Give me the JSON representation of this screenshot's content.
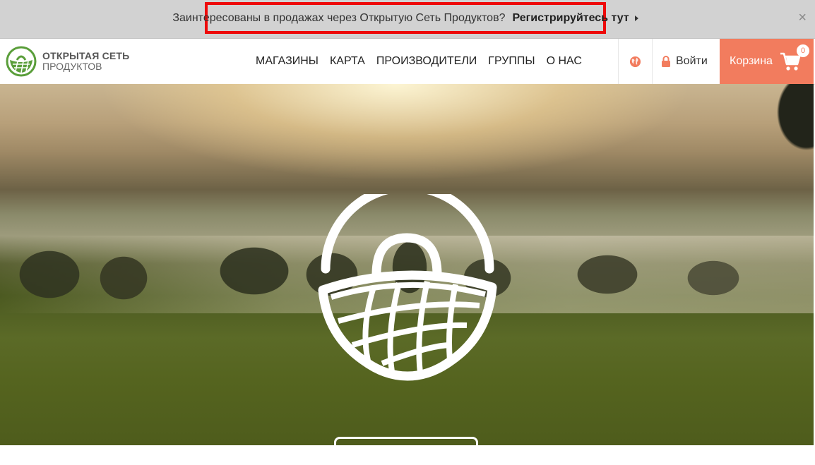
{
  "announcement": {
    "question": "Заинтересованы в продажах через Открытую Сеть Продуктов?",
    "cta": "Регистрируйтесь тут",
    "close": "×"
  },
  "header": {
    "logo_line1": "ОТКРЫТАЯ СЕТЬ",
    "logo_line2": "ПРОДУКТОВ",
    "menu": [
      {
        "label": "МАГАЗИНЫ"
      },
      {
        "label": "КАРТА"
      },
      {
        "label": "ПРОИЗВОДИТЕЛИ"
      },
      {
        "label": "ГРУППЫ"
      },
      {
        "label": "О НАС"
      }
    ],
    "login_label": "Войти",
    "cart_label": "Корзина",
    "cart_count": "0"
  },
  "colors": {
    "accent": "#f27c5e",
    "brand_green": "#5a9e3a",
    "highlight_border": "#ee0a0a"
  },
  "icons": {
    "globe": "globe-icon",
    "lock": "lock-icon",
    "cart": "cart-icon",
    "basket": "basket-icon"
  }
}
